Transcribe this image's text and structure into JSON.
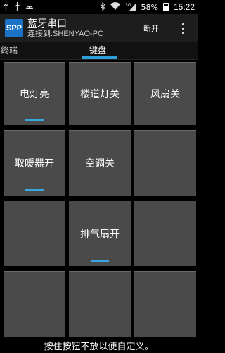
{
  "status_bar": {
    "icons": [
      "usb-icon",
      "usb-debug-icon",
      "android-icon",
      "bluetooth-icon",
      "wifi-icon",
      "signal-3g-icon"
    ],
    "network": "3G",
    "battery": "58%",
    "time": "15:22"
  },
  "action_bar": {
    "logo_text": "SPP",
    "title": "蓝牙串口",
    "subtitle": "连接到:SHENYAO-PC",
    "disconnect_label": "断开"
  },
  "tabs": {
    "terminal_label": "终端",
    "keyboard_label": "键盘",
    "active": "键盘"
  },
  "keys": [
    {
      "label": "电灯亮",
      "indicator": true
    },
    {
      "label": "楼道灯关",
      "indicator": false
    },
    {
      "label": "风扇关",
      "indicator": false
    },
    {
      "label": "取暖器开",
      "indicator": true
    },
    {
      "label": "空调关",
      "indicator": false
    },
    {
      "label": "",
      "indicator": false
    },
    {
      "label": "",
      "indicator": false
    },
    {
      "label": "排气扇开",
      "indicator": true
    },
    {
      "label": "",
      "indicator": false
    },
    {
      "label": "",
      "indicator": false
    },
    {
      "label": "",
      "indicator": false
    },
    {
      "label": "",
      "indicator": false
    }
  ],
  "hint": "按住按钮不放以便自定义。",
  "colors": {
    "accent": "#2e9fd9",
    "key_background": "#4a4a4a",
    "logo_background": "#1a73c6"
  }
}
